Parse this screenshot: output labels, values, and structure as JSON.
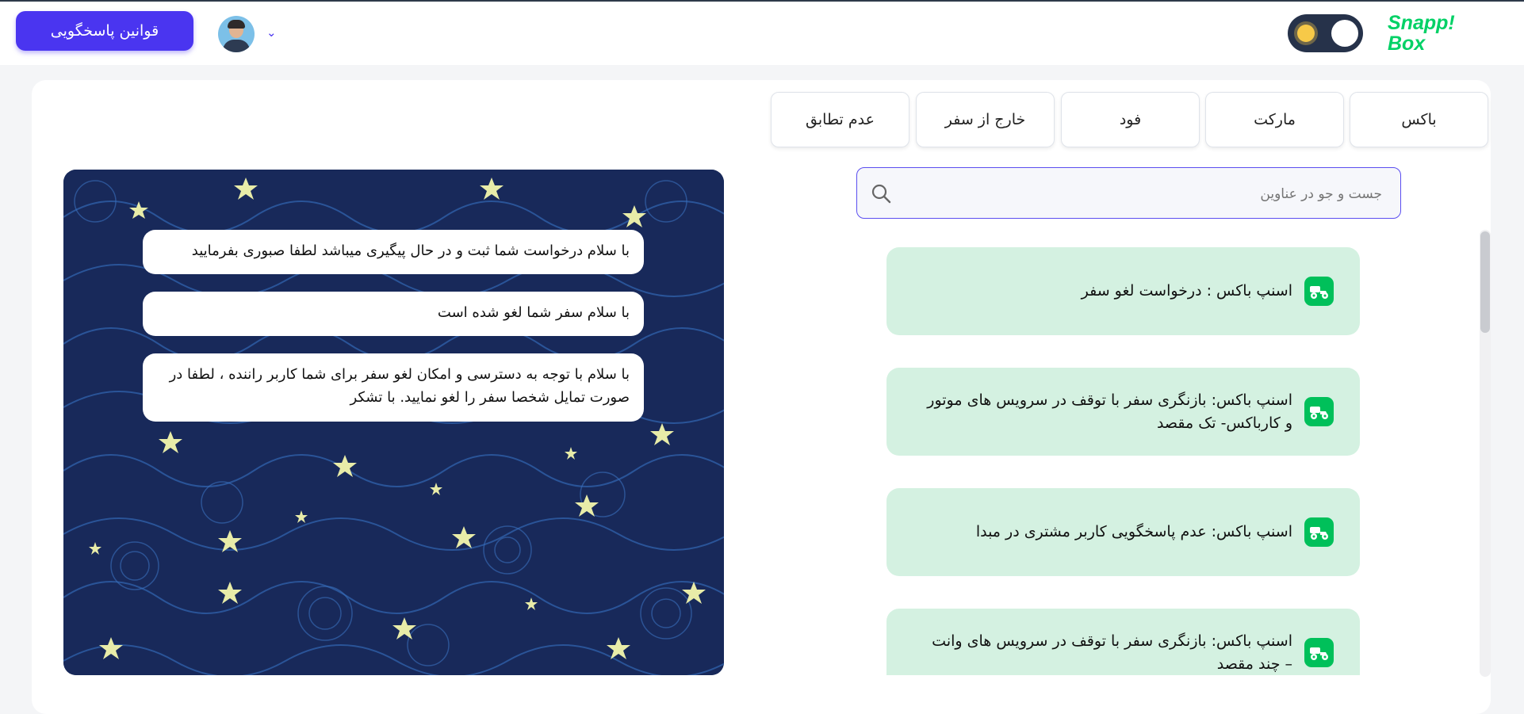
{
  "header": {
    "rules_button": "قوانین پاسخگویی",
    "logo_line1": "Snapp!",
    "logo_line2": "Box",
    "theme_toggle_icon": "sun-icon",
    "avatar_icon": "user-avatar",
    "dropdown_icon": "chevron-down-icon"
  },
  "tabs": [
    {
      "label": "باکس"
    },
    {
      "label": "مارکت"
    },
    {
      "label": "فود"
    },
    {
      "label": "خارج از سفر"
    },
    {
      "label": "عدم تطابق"
    }
  ],
  "search": {
    "placeholder": "جست و جو در عناوین",
    "icon": "search-icon"
  },
  "topics": [
    {
      "title": "اسنپ باکس : درخواست لغو سفر",
      "icon": "motorbike-icon"
    },
    {
      "title": "اسنپ باکس: بازنگری سفر با توقف در سرویس های موتور و کارباکس- تک مقصد",
      "icon": "motorbike-icon"
    },
    {
      "title": "اسنپ باکس: عدم پاسخگویی کاربر مشتری در مبدا",
      "icon": "motorbike-icon"
    },
    {
      "title": "اسنپ باکس: بازنگری سفر با توقف در سرویس های وانت – چند مقصد",
      "icon": "motorbike-icon"
    }
  ],
  "responses": [
    {
      "text": "با سلام درخواست شما ثبت و در حال پیگیری میباشد لطفا صبوری بفرمایید"
    },
    {
      "text": "با سلام سفر شما لغو شده است"
    },
    {
      "text": "با سلام با توجه به دسترسی و امکان لغو سفر برای شما کاربر راننده ، لطفا در صورت تمایل شخصا سفر را لغو نمایید. با تشکر"
    }
  ],
  "colors": {
    "accent": "#4a35f0",
    "brand_green": "#00d166",
    "topic_bg": "#d4f1e1",
    "panel_bg": "#1a2d58"
  }
}
